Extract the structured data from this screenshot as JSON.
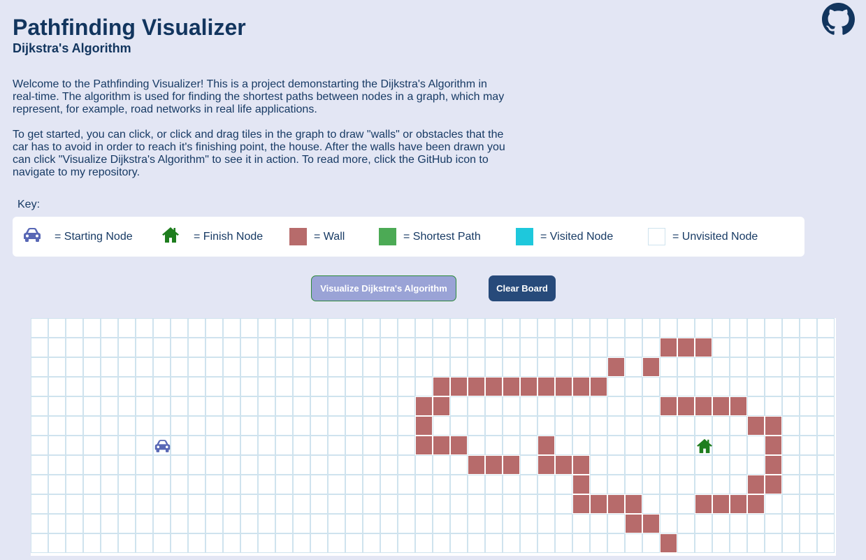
{
  "header": {
    "title": "Pathfinding Visualizer",
    "subtitle": "Dijkstra's Algorithm"
  },
  "intro": {
    "paragraph1": "Welcome to the Pathfinding Visualizer! This is a project demonstarting the Dijkstra's Algorithm in real-time. The algorithm is used for finding the shortest paths between nodes in a graph, which may represent, for example, road networks in real life applications.",
    "paragraph2": "To get started, you can click, or click and drag tiles in the graph to draw \"walls\" or obstacles that the car has to avoid in order to reach it's finishing point, the house. After the walls have been drawn you can click \"Visualize Dijkstra's Algorithm\" to see it in action. To read more, click the GitHub icon to navigate to my repository."
  },
  "key": {
    "label": "Key:",
    "items": [
      {
        "icon": "car-icon",
        "label": "= Starting Node",
        "color": "#5867b5"
      },
      {
        "icon": "house-icon",
        "label": "= Finish Node",
        "color": "#1e7d1e"
      },
      {
        "icon": "wall-swatch",
        "label": "= Wall",
        "color": "#b76b6b"
      },
      {
        "icon": "shortest-path-swatch",
        "label": "= Shortest Path",
        "color": "#4caa55"
      },
      {
        "icon": "visited-swatch",
        "label": "= Visited Node",
        "color": "#1ec8dc"
      },
      {
        "icon": "unvisited-swatch",
        "label": "= Unvisited Node",
        "color": "#ffffff"
      }
    ]
  },
  "buttons": {
    "visualize": "Visualize Dijkstra's Algorithm",
    "clear": "Clear Board"
  },
  "colors": {
    "background": "#e3e6f4",
    "wall": "#b76b6b",
    "grid_line": "#cfe3ee",
    "car": "#5867b5",
    "house": "#1e7d1e"
  },
  "grid": {
    "rows": 12,
    "cols": 46,
    "start": [
      6,
      7
    ],
    "finish": [
      6,
      38
    ],
    "walls": [
      [
        1,
        36
      ],
      [
        1,
        37
      ],
      [
        1,
        38
      ],
      [
        2,
        33
      ],
      [
        2,
        35
      ],
      [
        3,
        23
      ],
      [
        3,
        24
      ],
      [
        3,
        25
      ],
      [
        3,
        26
      ],
      [
        3,
        27
      ],
      [
        3,
        28
      ],
      [
        3,
        29
      ],
      [
        3,
        30
      ],
      [
        3,
        31
      ],
      [
        3,
        32
      ],
      [
        4,
        22
      ],
      [
        4,
        23
      ],
      [
        4,
        36
      ],
      [
        4,
        37
      ],
      [
        4,
        38
      ],
      [
        4,
        39
      ],
      [
        4,
        40
      ],
      [
        5,
        22
      ],
      [
        5,
        41
      ],
      [
        5,
        42
      ],
      [
        6,
        22
      ],
      [
        6,
        23
      ],
      [
        6,
        24
      ],
      [
        6,
        29
      ],
      [
        6,
        42
      ],
      [
        7,
        25
      ],
      [
        7,
        26
      ],
      [
        7,
        27
      ],
      [
        7,
        29
      ],
      [
        7,
        30
      ],
      [
        7,
        31
      ],
      [
        7,
        42
      ],
      [
        8,
        31
      ],
      [
        8,
        41
      ],
      [
        8,
        42
      ],
      [
        9,
        31
      ],
      [
        9,
        32
      ],
      [
        9,
        33
      ],
      [
        9,
        34
      ],
      [
        9,
        38
      ],
      [
        9,
        39
      ],
      [
        9,
        40
      ],
      [
        9,
        41
      ],
      [
        10,
        34
      ],
      [
        10,
        35
      ],
      [
        11,
        36
      ]
    ]
  }
}
